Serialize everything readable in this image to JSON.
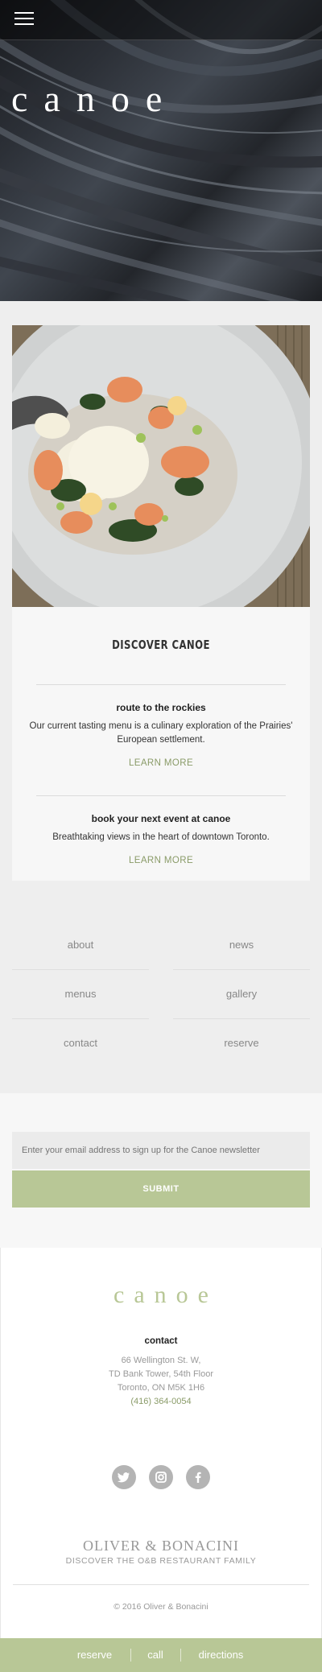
{
  "header": {
    "logo": "canoe",
    "menu_icon": "hamburger-menu-icon"
  },
  "feature": {
    "title": "DISCOVER CANOE",
    "promos": [
      {
        "heading": "route to the rockies",
        "text": "Our current tasting menu is a culinary exploration of the Prairies' European settlement.",
        "link": "LEARN MORE"
      },
      {
        "heading": "book your next event at canoe",
        "text": "Breathtaking views in the heart of downtown Toronto.",
        "link": "LEARN MORE"
      }
    ]
  },
  "nav": {
    "items": [
      "about",
      "news",
      "menus",
      "gallery",
      "contact",
      "reserve"
    ]
  },
  "newsletter": {
    "placeholder": "Enter your email address to sign up for the Canoe newsletter",
    "submit": "SUBMIT"
  },
  "footer": {
    "logo": "canoe",
    "contact_heading": "contact",
    "address_line1": "66 Wellington St. W,",
    "address_line2": "TD Bank Tower, 54th Floor",
    "address_line3": "Toronto, ON M5K 1H6",
    "phone": "(416) 364-0054",
    "social_icons": [
      "twitter-icon",
      "instagram-icon",
      "facebook-icon"
    ],
    "brand": "OLIVER & BONACINI",
    "brand_tagline": "DISCOVER THE O&B RESTAURANT FAMILY",
    "copyright": "© 2016 Oliver & Bonacini"
  },
  "bottom_bar": {
    "items": [
      "reserve",
      "call",
      "directions"
    ]
  },
  "colors": {
    "accent": "#b8c796",
    "link": "#8a9b68"
  }
}
